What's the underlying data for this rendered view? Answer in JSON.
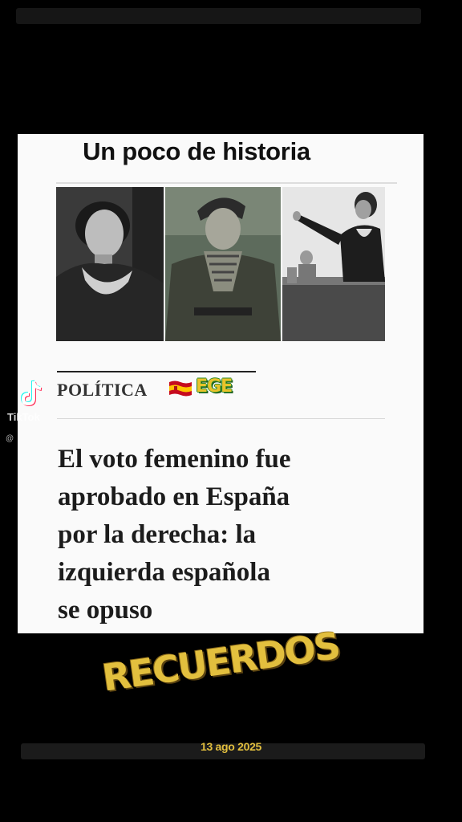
{
  "card": {
    "title": "Un poco de historia",
    "section_label": "POLÍTICA",
    "flag_icon": "spain-flag-icon",
    "tag": "EGE",
    "headline_lines": [
      "El voto femenino fue",
      "aprobado en España",
      "por la derecha: la",
      "izquierda española",
      "se opuso"
    ]
  },
  "overlay": {
    "app_icon": "tiktok-icon",
    "app_name": "TikTok",
    "handle": "@"
  },
  "caption": {
    "stamp": "RECUERDOS",
    "date": "13 ago 2025"
  },
  "colors": {
    "background": "#000000",
    "card": "#fafafa",
    "stamp_gold": "#e2bf3e",
    "tag_green": "#2b8a2b"
  }
}
